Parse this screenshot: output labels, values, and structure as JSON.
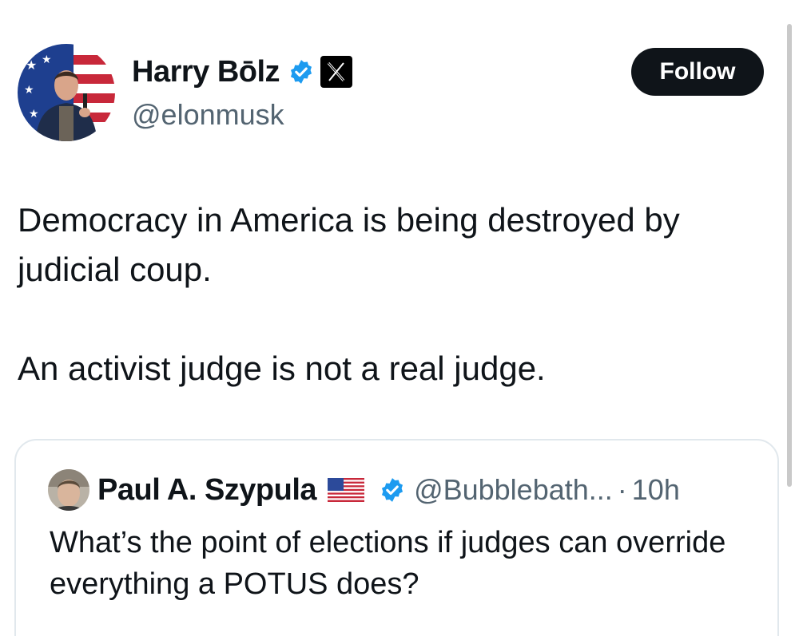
{
  "tweet": {
    "author": {
      "display_name": "Harry Bōlz",
      "handle": "@elonmusk",
      "verified": true,
      "affiliation_badge": "x-logo-icon"
    },
    "follow_label": "Follow",
    "text_paragraphs": [
      "Democracy in America is being destroyed by judicial coup.",
      "An activist judge is not a real judge."
    ]
  },
  "quoted_tweet": {
    "author": {
      "display_name": "Paul A. Szypula",
      "name_emoji": "us-flag-icon",
      "verified": true,
      "handle": "@Bubblebath...",
      "separator": "·",
      "time": "10h"
    },
    "text": "What’s the point of elections if judges can override everything a POTUS does?"
  },
  "colors": {
    "primary_text": "#0f1419",
    "secondary_text": "#536471",
    "verified_blue": "#1d9bf0",
    "follow_button_bg": "#0f1419",
    "card_border": "#e1e8ed"
  }
}
